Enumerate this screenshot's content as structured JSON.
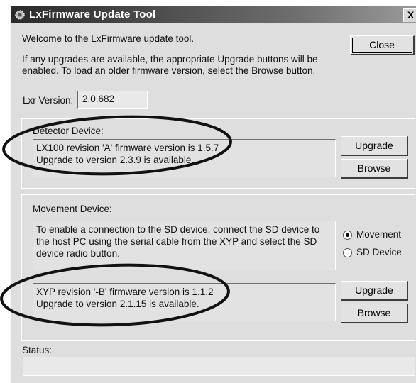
{
  "window": {
    "title": "LxFirmware Update Tool",
    "close_glyph": "X"
  },
  "intro": {
    "welcome": "Welcome to the LxFirmware update tool.",
    "info_line1": "If any upgrades are available, the appropriate Upgrade buttons will be",
    "info_line2": "enabled.  To load an older firmware version, select the Browse button."
  },
  "close_button": "Close",
  "lxr": {
    "label": "Lxr Version:",
    "value": "2.0.682"
  },
  "detector": {
    "label": "Detector Device:",
    "status_line1": "LX100 revision 'A' firmware version is 1.5.7",
    "status_line2": "Upgrade to version 2.3.9 is available.",
    "upgrade_button": "Upgrade",
    "browse_button": "Browse"
  },
  "movement": {
    "label": "Movement Device:",
    "info_line1": "To enable a connection to the SD device, connect the SD device to",
    "info_line2": "the host PC using the serial cable from the XYP and select the SD",
    "info_line3": "device radio button.",
    "status_line1": "XYP revision '-B' firmware version is 1.1.2",
    "status_line2": "Upgrade to version 2.1.15 is available.",
    "upgrade_button": "Upgrade",
    "browse_button": "Browse",
    "radio_movement": "Movement",
    "radio_sd": "SD Device",
    "selected_radio": "Movement"
  },
  "status": {
    "label": "Status:",
    "value": ""
  }
}
